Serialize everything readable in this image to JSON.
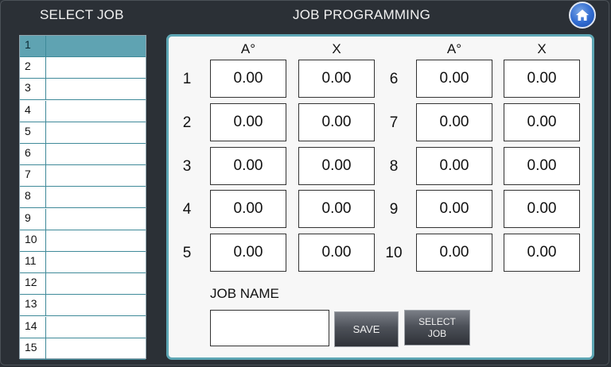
{
  "header": {
    "select_job_title": "SELECT JOB",
    "programming_title": "JOB PROGRAMMING"
  },
  "job_list": {
    "selected_index": 0,
    "items": [
      {
        "num": "1",
        "name": ""
      },
      {
        "num": "2",
        "name": ""
      },
      {
        "num": "3",
        "name": ""
      },
      {
        "num": "4",
        "name": ""
      },
      {
        "num": "5",
        "name": ""
      },
      {
        "num": "6",
        "name": ""
      },
      {
        "num": "7",
        "name": ""
      },
      {
        "num": "8",
        "name": ""
      },
      {
        "num": "9",
        "name": ""
      },
      {
        "num": "10",
        "name": ""
      },
      {
        "num": "11",
        "name": ""
      },
      {
        "num": "12",
        "name": ""
      },
      {
        "num": "13",
        "name": ""
      },
      {
        "num": "14",
        "name": ""
      },
      {
        "num": "15",
        "name": ""
      }
    ]
  },
  "grid": {
    "left_headers": {
      "angle": "A°",
      "x": "X"
    },
    "right_headers": {
      "angle": "A°",
      "x": "X"
    },
    "left_rows": [
      {
        "label": "1",
        "angle": "0.00",
        "x": "0.00"
      },
      {
        "label": "2",
        "angle": "0.00",
        "x": "0.00"
      },
      {
        "label": "3",
        "angle": "0.00",
        "x": "0.00"
      },
      {
        "label": "4",
        "angle": "0.00",
        "x": "0.00"
      },
      {
        "label": "5",
        "angle": "0.00",
        "x": "0.00"
      }
    ],
    "right_rows": [
      {
        "label": "6",
        "angle": "0.00",
        "x": "0.00"
      },
      {
        "label": "7",
        "angle": "0.00",
        "x": "0.00"
      },
      {
        "label": "8",
        "angle": "0.00",
        "x": "0.00"
      },
      {
        "label": "9",
        "angle": "0.00",
        "x": "0.00"
      },
      {
        "label": "10",
        "angle": "0.00",
        "x": "0.00"
      }
    ]
  },
  "job_name": {
    "label": "JOB NAME",
    "value": ""
  },
  "buttons": {
    "save": "SAVE",
    "select_job": "SELECT\nJOB",
    "home_icon": "home-icon"
  },
  "colors": {
    "background": "#2b3036",
    "accent": "#5da6b4",
    "selected_row": "#5fa3b2",
    "home_button": "#2f6ad0"
  }
}
